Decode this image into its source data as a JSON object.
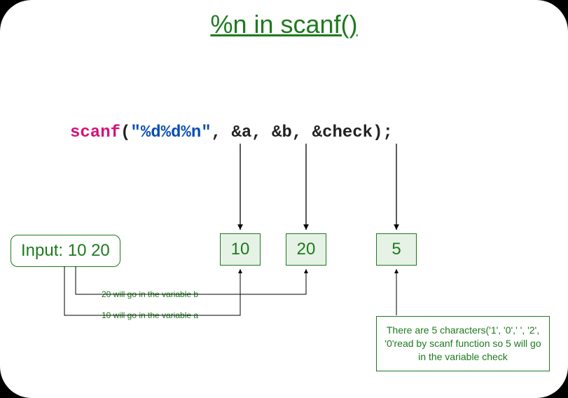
{
  "title": "%n in scanf()",
  "code": {
    "fn": "scanf",
    "open": "(",
    "str": "\"%d%d%n\"",
    "args": ", &a, &b, &check);"
  },
  "input": {
    "label": "Input: 10 20"
  },
  "values": {
    "a": "10",
    "b": "20",
    "check": "5"
  },
  "captions": {
    "b_goes": "20 will go in the variable b",
    "a_goes": "10 will go in the variable a"
  },
  "explain": "There are 5 characters('1', '0',' ', '2', '0'read by scanf function so 5 will go in the variable check"
}
